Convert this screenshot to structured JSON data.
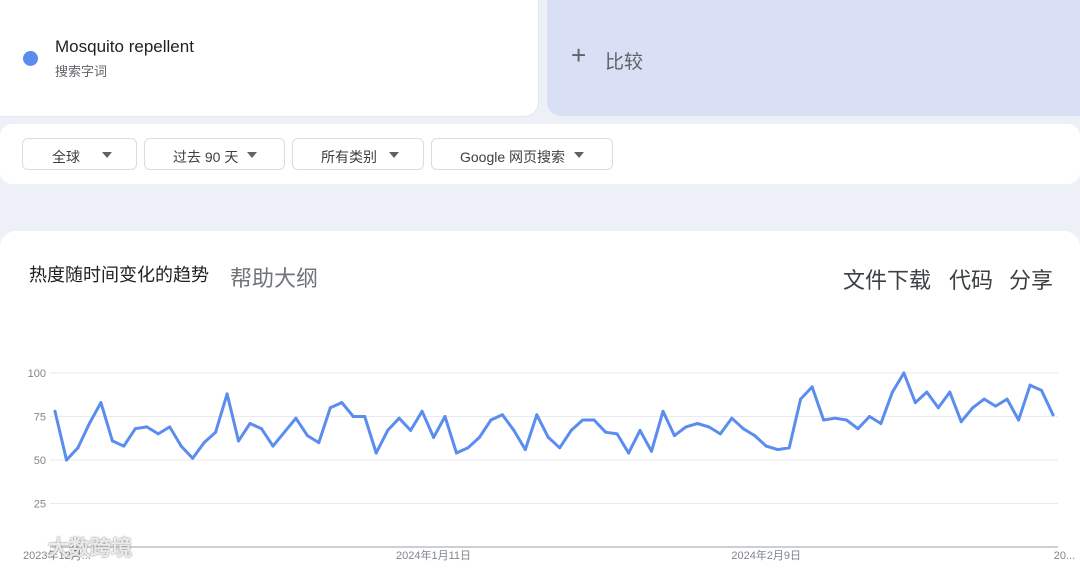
{
  "search_term": {
    "name": "Mosquito repellent",
    "subtitle": "搜索字词",
    "color": "#5b8def"
  },
  "compare": {
    "plus": "+",
    "label": "比较"
  },
  "filters": [
    {
      "label": "全球"
    },
    {
      "label": "过去 90 天"
    },
    {
      "label": "所有类别"
    },
    {
      "label": "Google 网页搜索"
    }
  ],
  "chart_section": {
    "title": "热度随时间变化的趋势",
    "help": "帮助大纲",
    "actions": {
      "download": "文件下载",
      "code": "代码",
      "share": "分享"
    }
  },
  "watermark": "大数跨境",
  "chart_data": {
    "type": "line",
    "title": "",
    "xlabel": "",
    "ylabel": "",
    "ylim": [
      0,
      100
    ],
    "yticks": [
      25,
      50,
      75,
      100
    ],
    "x_tick_labels": [
      {
        "index": 0,
        "label": "2023年12月..."
      },
      {
        "index": 33,
        "label": "2024年1月11日"
      },
      {
        "index": 62,
        "label": "2024年2月9日"
      },
      {
        "index": 88,
        "label": "20..."
      }
    ],
    "series": [
      {
        "color": "#5b8def",
        "values": [
          78,
          50,
          57,
          71,
          83,
          61,
          58,
          68,
          69,
          65,
          69,
          58,
          51,
          60,
          66,
          88,
          61,
          71,
          68,
          58,
          66,
          74,
          64,
          60,
          80,
          83,
          75,
          75,
          54,
          67,
          74,
          67,
          78,
          63,
          75,
          54,
          57,
          63,
          73,
          76,
          67,
          56,
          76,
          63,
          57,
          67,
          73,
          73,
          66,
          65,
          54,
          67,
          55,
          78,
          64,
          69,
          71,
          69,
          65,
          74,
          68,
          64,
          58,
          56,
          57,
          85,
          92,
          73,
          74,
          73,
          68,
          75,
          71,
          89,
          100,
          83,
          89,
          80,
          89,
          72,
          80,
          85,
          81,
          85,
          73,
          93,
          90,
          76
        ]
      }
    ]
  }
}
